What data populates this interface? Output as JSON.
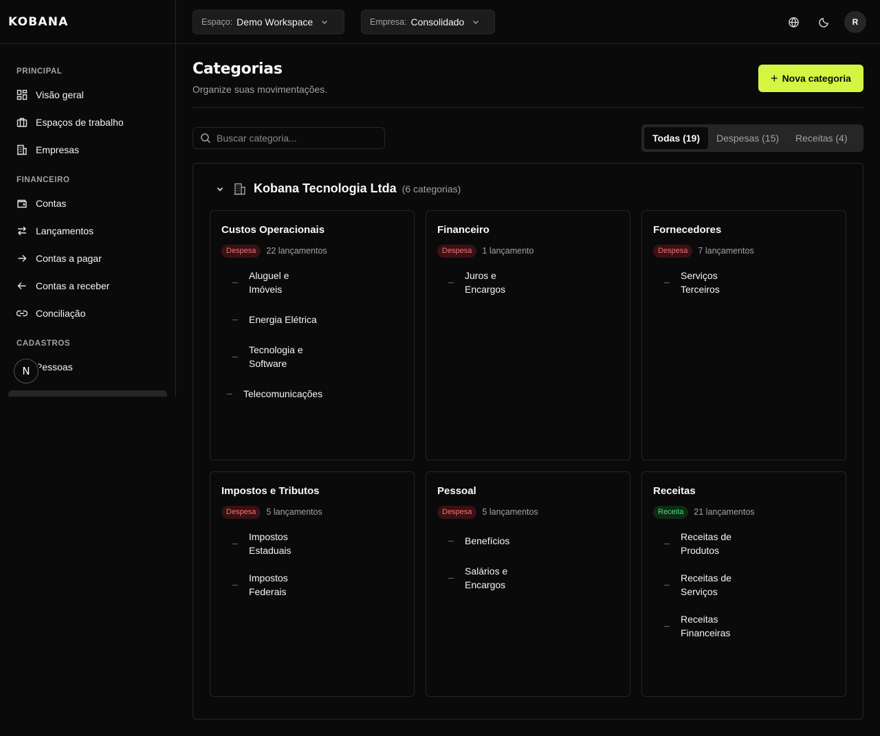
{
  "brand": "KOBANA",
  "header": {
    "workspace": {
      "label": "Espaço:",
      "value": "Demo Workspace"
    },
    "company": {
      "label": "Empresa:",
      "value": "Consolidado"
    },
    "avatar": "R"
  },
  "sidebar": {
    "sections": [
      {
        "label": "PRINCIPAL",
        "items": [
          {
            "label": "Visão geral",
            "icon": "dashboard-icon"
          },
          {
            "label": "Espaços de trabalho",
            "icon": "briefcase-icon"
          },
          {
            "label": "Empresas",
            "icon": "building-icon"
          }
        ]
      },
      {
        "label": "FINANCEIRO",
        "items": [
          {
            "label": "Contas",
            "icon": "wallet-icon"
          },
          {
            "label": "Lançamentos",
            "icon": "arrows-left-right-icon"
          },
          {
            "label": "Contas a pagar",
            "icon": "arrow-right-icon"
          },
          {
            "label": "Contas a receber",
            "icon": "arrow-left-icon"
          },
          {
            "label": "Conciliação",
            "icon": "link-icon"
          }
        ]
      },
      {
        "label": "CADASTROS",
        "items": [
          {
            "label": "Pessoas",
            "icon": "users-icon"
          }
        ]
      }
    ],
    "badge": "N"
  },
  "main": {
    "title": "Categorias",
    "subtitle": "Organize suas movimentações.",
    "new_button": "Nova categoria",
    "search_placeholder": "Buscar categoria...",
    "tabs": [
      {
        "label": "Todas (19)",
        "active": true
      },
      {
        "label": "Despesas (15)",
        "active": false
      },
      {
        "label": "Receitas (4)",
        "active": false
      }
    ],
    "group": {
      "name": "Kobana Tecnologia Ltda",
      "count": "(6 categorias)",
      "cards": [
        {
          "title": "Custos Operacionais",
          "type": "Despesa",
          "count": "22 lançamentos",
          "subs": [
            "Aluguel e Imóveis",
            "Energia Elétrica",
            "Tecnologia e Software",
            "Telecomunicações"
          ]
        },
        {
          "title": "Financeiro",
          "type": "Despesa",
          "count": "1 lançamento",
          "subs": [
            "Juros e Encargos"
          ]
        },
        {
          "title": "Fornecedores",
          "type": "Despesa",
          "count": "7 lançamentos",
          "subs": [
            "Serviços Terceiros"
          ]
        },
        {
          "title": "Impostos e Tributos",
          "type": "Despesa",
          "count": "5 lançamentos",
          "subs": [
            "Impostos Estaduais",
            "Impostos Federais"
          ]
        },
        {
          "title": "Pessoal",
          "type": "Despesa",
          "count": "5 lançamentos",
          "subs": [
            "Benefícios",
            "Salários e Encargos"
          ]
        },
        {
          "title": "Receitas",
          "type": "Receita",
          "count": "21 lançamentos",
          "subs": [
            "Receitas de Produtos",
            "Receitas de Serviços",
            "Receitas Financeiras"
          ]
        }
      ]
    }
  },
  "colors": {
    "accent": "#d4f542",
    "expense": "#f87171",
    "income": "#4ade80",
    "background": "#0a0a0a",
    "border": "#262626"
  }
}
